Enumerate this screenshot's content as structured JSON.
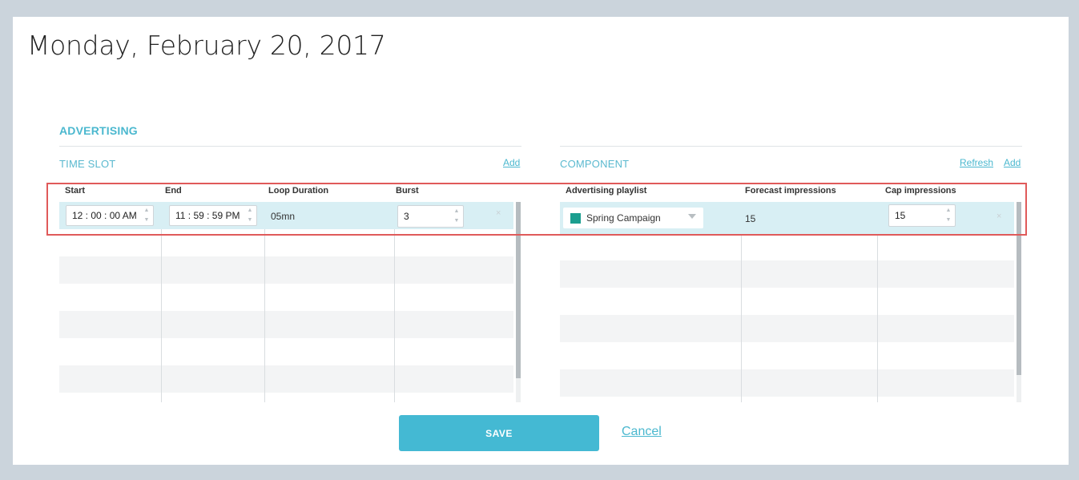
{
  "page": {
    "title": "Monday, February 20, 2017"
  },
  "advertising": {
    "title": "ADVERTISING",
    "time_slot": {
      "title": "TIME SLOT",
      "add_label": "Add",
      "columns": [
        "Start",
        "End",
        "Loop Duration",
        "Burst"
      ],
      "row": {
        "start": "12 : 00 : 00 AM",
        "end": "11 : 59 : 59 PM",
        "loop_duration": "05mn",
        "burst": "3",
        "delete_icon": "×"
      }
    },
    "component": {
      "title": "COMPONENT",
      "refresh_label": "Refresh",
      "add_label": "Add",
      "columns": [
        "Advertising playlist",
        "Forecast impressions",
        "Cap impressions"
      ],
      "row": {
        "playlist": "Spring Campaign",
        "playlist_color": "#1a9e8f",
        "forecast_impressions": "15",
        "cap_impressions": "15",
        "delete_icon": "×"
      }
    }
  },
  "actions": {
    "save_label": "SAVE",
    "cancel_label": "Cancel"
  },
  "colors": {
    "accent": "#44b9d3",
    "highlight": "#e05a5a",
    "selected_row": "#d8eff4"
  }
}
